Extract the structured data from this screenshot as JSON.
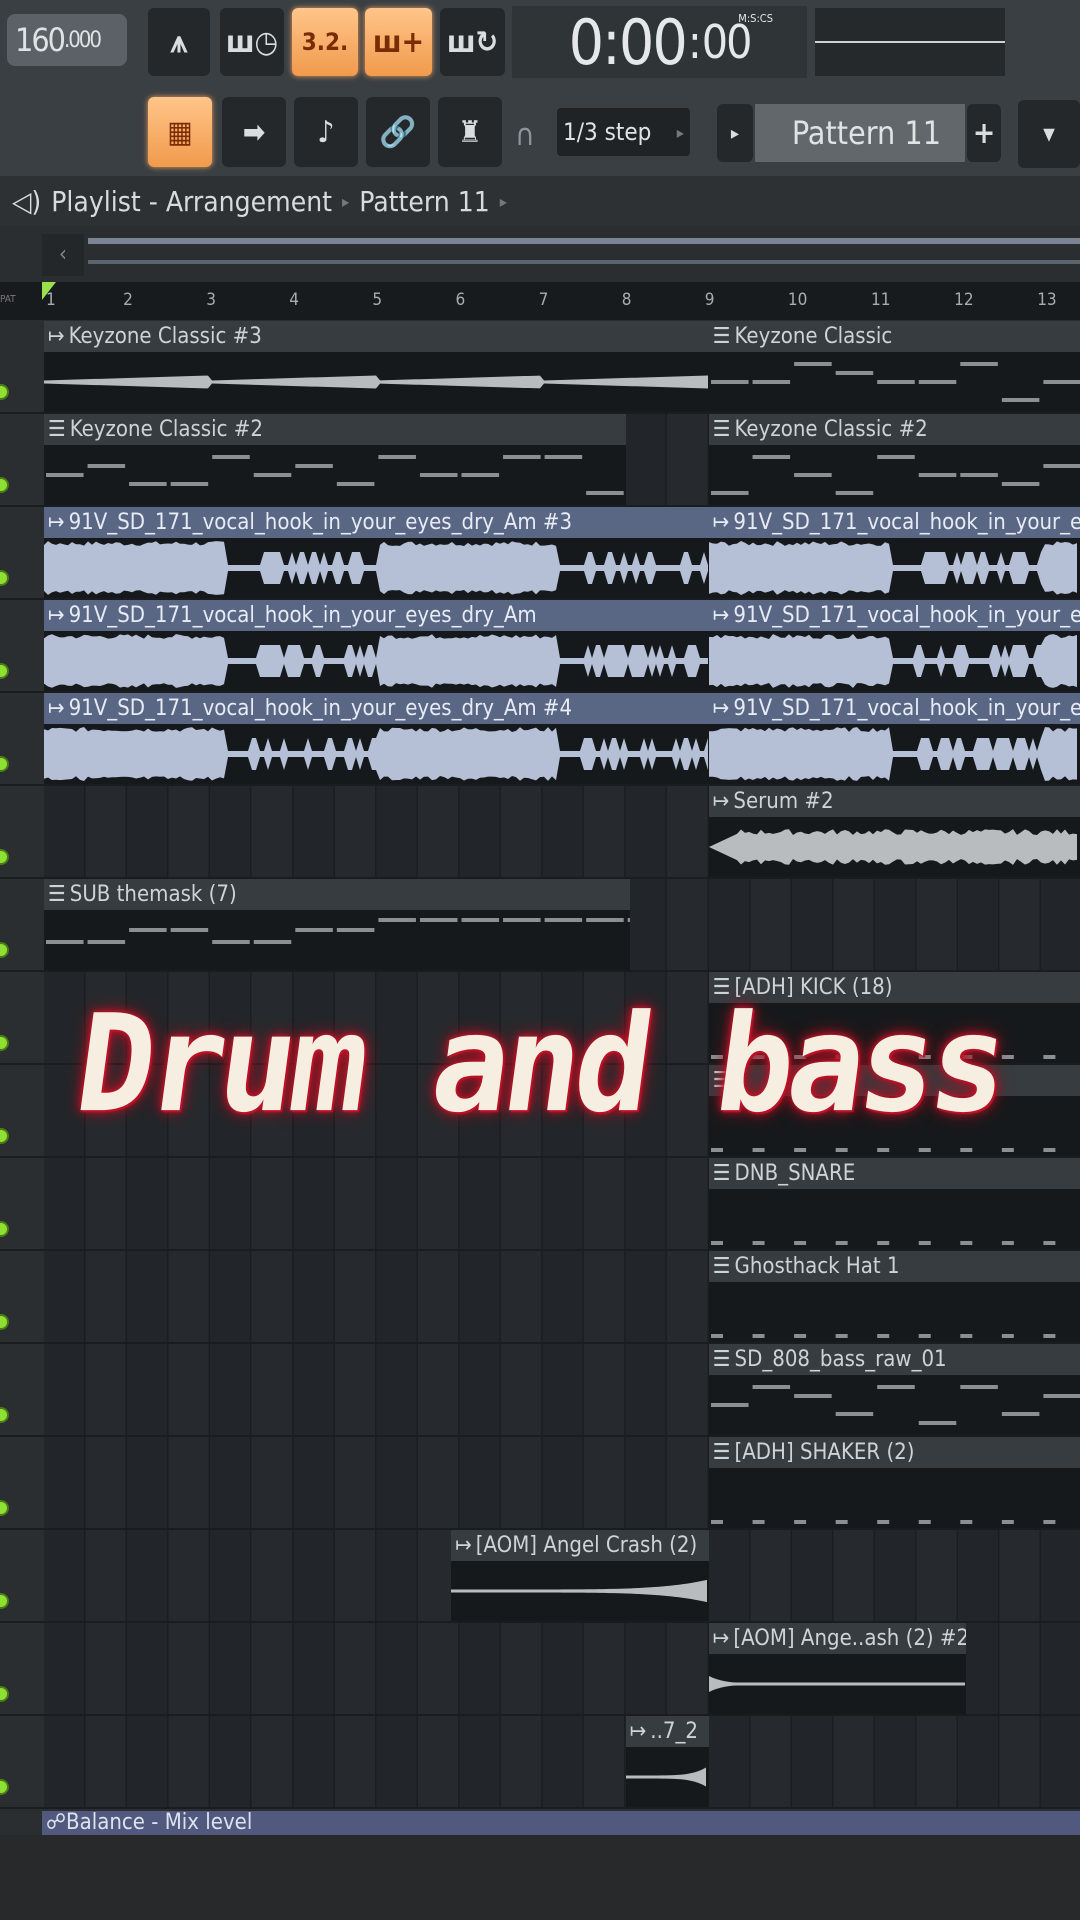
{
  "toolbar": {
    "tempo": "160",
    "tempo_dec": ".000",
    "song_pos_label": "3.2.",
    "time_main": "0:00",
    "time_cs": "00",
    "time_format": "M:S:CS",
    "snap": "1/3 step",
    "pattern": "Pattern 11",
    "add": "+"
  },
  "breadcrumb": {
    "title": "Playlist - Arrangement",
    "pattern": "Pattern 11"
  },
  "ruler": {
    "pat_label": "PAT",
    "bars": [
      "1",
      "2",
      "3",
      "4",
      "5",
      "6",
      "7",
      "8",
      "9",
      "10",
      "11",
      "12",
      "13"
    ]
  },
  "tracks": [
    [
      {
        "name": "Keyzone Classic #3",
        "type": "audio",
        "start": 1,
        "end": 9,
        "kind": "thin"
      },
      {
        "name": "Keyzone Classic",
        "type": "pattern",
        "start": 9,
        "end": 14,
        "kind": "notes"
      }
    ],
    [
      {
        "name": "Keyzone Classic #2",
        "type": "pattern",
        "start": 1,
        "end": 8,
        "kind": "notes"
      },
      {
        "name": "Keyzone Classic #2",
        "type": "pattern",
        "start": 9,
        "end": 14,
        "kind": "notes"
      }
    ],
    [
      {
        "name": "91V_SD_171_vocal_hook_in_your_eyes_dry_Am #3",
        "type": "audio",
        "start": 1,
        "end": 9,
        "kind": "vocal",
        "blue": true
      },
      {
        "name": "91V_SD_171_vocal_hook_in_your_eyes_dry_Am #3",
        "type": "audio",
        "start": 9,
        "end": 14,
        "kind": "vocal",
        "blue": true
      }
    ],
    [
      {
        "name": "91V_SD_171_vocal_hook_in_your_eyes_dry_Am",
        "type": "audio",
        "start": 1,
        "end": 9,
        "kind": "vocal",
        "blue": true
      },
      {
        "name": "91V_SD_171_vocal_hook_in_your_eyes_dry_Am",
        "type": "audio",
        "start": 9,
        "end": 14,
        "kind": "vocal",
        "blue": true
      }
    ],
    [
      {
        "name": "91V_SD_171_vocal_hook_in_your_eyes_dry_Am #4",
        "type": "audio",
        "start": 1,
        "end": 9,
        "kind": "vocal",
        "blue": true
      },
      {
        "name": "91V_SD_171_vocal_hook_in_your_eyes_dry_Am #4",
        "type": "audio",
        "start": 9,
        "end": 14,
        "kind": "vocal",
        "blue": true
      }
    ],
    [
      {
        "name": "Serum #2",
        "type": "audio",
        "start": 9,
        "end": 14,
        "kind": "pad"
      }
    ],
    [
      {
        "name": "SUB themask (7)",
        "type": "pattern",
        "start": 1,
        "end": 8.05,
        "kind": "sub"
      }
    ],
    [
      {
        "name": "[ADH] KICK (18)",
        "type": "pattern",
        "start": 9,
        "end": 14,
        "kind": "drums"
      }
    ],
    [
      {
        "name": "",
        "type": "pattern",
        "start": 9,
        "end": 14,
        "kind": "drums"
      }
    ],
    [
      {
        "name": "DNB_SNARE",
        "type": "pattern",
        "start": 9,
        "end": 14,
        "kind": "drums"
      }
    ],
    [
      {
        "name": "Ghosthack Hat 1",
        "type": "pattern",
        "start": 9,
        "end": 14,
        "kind": "drums"
      }
    ],
    [
      {
        "name": "SD_808_bass_raw_01",
        "type": "pattern",
        "start": 9,
        "end": 14,
        "kind": "notes"
      }
    ],
    [
      {
        "name": "[ADH] SHAKER (2)",
        "type": "pattern",
        "start": 9,
        "end": 14,
        "kind": "drums"
      }
    ],
    [
      {
        "name": "[AOM] Angel Crash (2)",
        "type": "audio",
        "start": 5.9,
        "end": 9,
        "kind": "crash"
      }
    ],
    [
      {
        "name": "[AOM] Ange..ash (2) #2",
        "type": "audio",
        "start": 9,
        "end": 12.1,
        "kind": "crash2"
      }
    ],
    [
      {
        "name": "..7_2",
        "type": "audio",
        "start": 8,
        "end": 9,
        "kind": "crash"
      }
    ]
  ],
  "automation": {
    "label": "Balance - Mix level"
  },
  "overlay": {
    "title": "Drum and bass"
  },
  "colors": {
    "accent": "#f19a4c",
    "led": "#8fe032",
    "clip_blue": "#5a6784"
  }
}
